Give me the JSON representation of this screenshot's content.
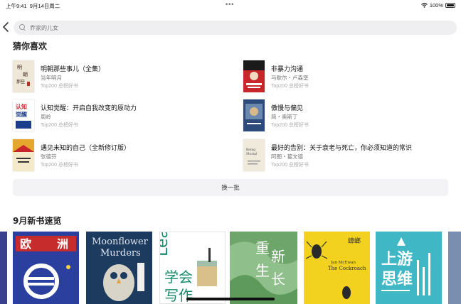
{
  "status_bar": {
    "time": "上午9:41",
    "date": "9月14日周二",
    "dots": "•••",
    "battery": "100%"
  },
  "search": {
    "placeholder": "乔家的儿女"
  },
  "recommend": {
    "title": "猜你喜欢",
    "items": [
      {
        "title": "明朝那些事儿（全集）",
        "author": "当年明月",
        "rank": "Top200 总榜好书"
      },
      {
        "title": "非暴力沟通",
        "author": "马歇尔・卢森堡",
        "rank": "Top200 总榜好书"
      },
      {
        "title": "认知觉醒：开启自我改变的原动力",
        "author": "周岭",
        "rank": "Top200 总榜好书"
      },
      {
        "title": "傲慢与偏见",
        "author": "简・奥斯丁",
        "rank": "Top200 总榜好书"
      },
      {
        "title": "遇见未知的自己（全新修订版）",
        "author": "张德芬",
        "rank": "Top200 总榜好书"
      },
      {
        "title": "最好的告别：关于衰老与死亡，你必须知道的常识",
        "author": "阿图・葛文德",
        "rank": "Top200 总榜好书"
      }
    ],
    "refresh_label": "换一批"
  },
  "new_books": {
    "title": "9月新书速览",
    "covers": [
      {
        "text": "欧 洲",
        "bg": "#2b3f9e"
      },
      {
        "text": "Moonflower Murders",
        "bg": "#1d3a5f"
      },
      {
        "text": "Learn to 学会写作",
        "bg": "#ffffff"
      },
      {
        "text": "重新生长",
        "bg": "#8fbf8a"
      },
      {
        "text": "The Cockroach",
        "bg": "#f2d21e"
      },
      {
        "text": "上游思维",
        "bg": "#3fb7c4"
      }
    ]
  }
}
